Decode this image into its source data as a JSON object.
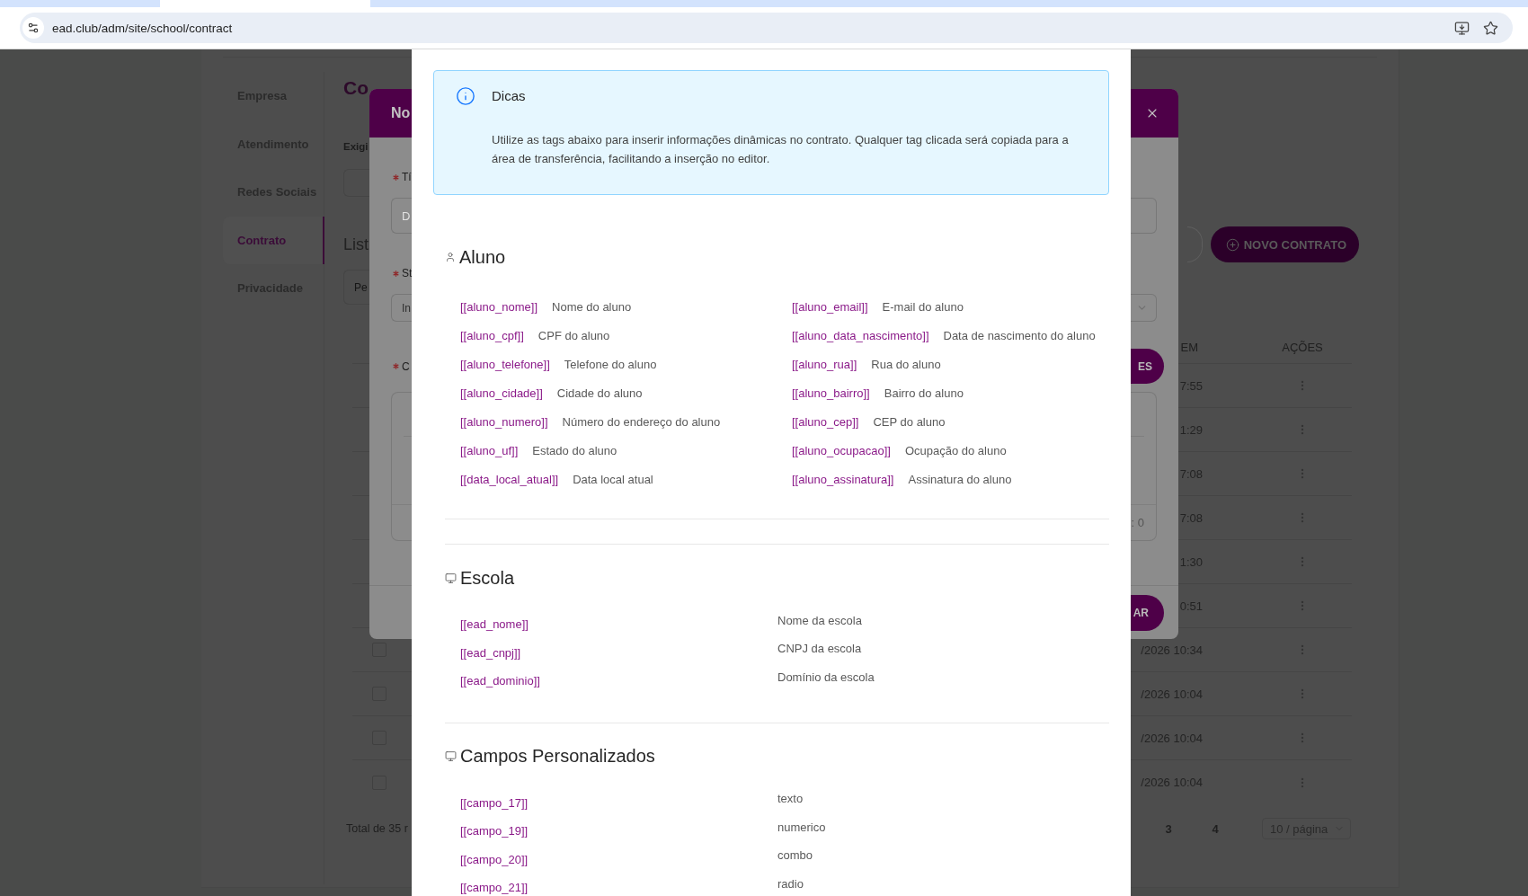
{
  "browser": {
    "tabs": [
      {
        "selected": true
      }
    ],
    "url": "ead.club/adm/site/school/contract"
  },
  "sidebar": {
    "items": [
      {
        "label": "Empresa",
        "selected": false
      },
      {
        "label": "Atendimento",
        "selected": false
      },
      {
        "label": "Redes Sociais",
        "selected": false
      },
      {
        "label": "Contrato",
        "selected": true
      },
      {
        "label": "Privacidade",
        "selected": false
      }
    ]
  },
  "page": {
    "title": "Co",
    "field_label": "Exigi",
    "list_title": "List",
    "search": {
      "placeholder": "Pe"
    },
    "new_button": "NOVO CONTRATO"
  },
  "table": {
    "columns": [
      "EM",
      "AÇÕES"
    ],
    "rows": [
      {
        "created": "7:55"
      },
      {
        "created": "1:29"
      },
      {
        "created": "7:08"
      },
      {
        "created": "7:08"
      },
      {
        "created": "1:30"
      },
      {
        "created": "0:51"
      },
      {
        "created": "/2026 10:34",
        "checked": false
      },
      {
        "created": "/2026 10:04",
        "checked": false
      },
      {
        "created": "/2026 10:04",
        "checked": false
      },
      {
        "created": "/2026 10:04",
        "checked": false
      }
    ]
  },
  "footer": {
    "total": "Total de 35 r",
    "pages": [
      {
        "label": "3",
        "selected": false
      },
      {
        "label": "4",
        "selected": false
      }
    ],
    "page_size": "10 / página"
  },
  "back_modal": {
    "title": "No",
    "fields": [
      {
        "kind": "input",
        "label": "Tí",
        "required": true,
        "placeholder": "D"
      },
      {
        "kind": "select",
        "label": "St",
        "required": true,
        "value": "In"
      },
      {
        "kind": "editor",
        "label": "C",
        "required": true,
        "button": "ES",
        "counter": ": 0"
      }
    ],
    "save_button": "AR"
  },
  "tips_modal": {
    "alert": {
      "title": "Dicas",
      "text": "Utilize as tags abaixo para inserir informações dinâmicas no contrato. Qualquer tag clicada será copiada para a área de transferência, facilitando a inserção no editor."
    },
    "sections": [
      {
        "kind": "student",
        "title": "Aluno",
        "tags": [
          {
            "tag": "[[aluno_nome]]",
            "description": "Nome do aluno"
          },
          {
            "tag": "[[aluno_email]]",
            "description": "E-mail do aluno"
          },
          {
            "tag": "[[aluno_cpf]]",
            "description": "CPF do aluno"
          },
          {
            "tag": "[[aluno_data_nascimento]]",
            "description": "Data de nascimento do aluno"
          },
          {
            "tag": "[[aluno_telefone]]",
            "description": "Telefone do aluno"
          },
          {
            "tag": "[[aluno_rua]]",
            "description": "Rua do aluno"
          },
          {
            "tag": "[[aluno_cidade]]",
            "description": "Cidade do aluno"
          },
          {
            "tag": "[[aluno_bairro]]",
            "description": "Bairro do aluno"
          },
          {
            "tag": "[[aluno_numero]]",
            "description": "Número do endereço do aluno"
          },
          {
            "tag": "[[aluno_cep]]",
            "description": "CEP do aluno"
          },
          {
            "tag": "[[aluno_uf]]",
            "description": "Estado do aluno"
          },
          {
            "tag": "[[aluno_ocupacao]]",
            "description": "Ocupação do aluno"
          },
          {
            "tag": "[[data_local_atual]]",
            "description": "Data local atual"
          },
          {
            "tag": "[[aluno_assinatura]]",
            "description": "Assinatura do aluno"
          }
        ]
      },
      {
        "kind": "school",
        "title": "Escola",
        "tags": [
          {
            "tag": "[[ead_nome]]",
            "description": "Nome da escola"
          },
          {
            "tag": "[[ead_cnpj]]",
            "description": "CNPJ da escola"
          },
          {
            "tag": "[[ead_dominio]]",
            "description": "Domínio da escola"
          }
        ]
      },
      {
        "kind": "custom",
        "title": "Campos Personalizados",
        "tags": [
          {
            "tag": "[[campo_17]]",
            "description": "texto"
          },
          {
            "tag": "[[campo_19]]",
            "description": "numerico"
          },
          {
            "tag": "[[campo_20]]",
            "description": "combo"
          },
          {
            "tag": "[[campo_21]]",
            "description": "radio"
          }
        ]
      }
    ]
  }
}
